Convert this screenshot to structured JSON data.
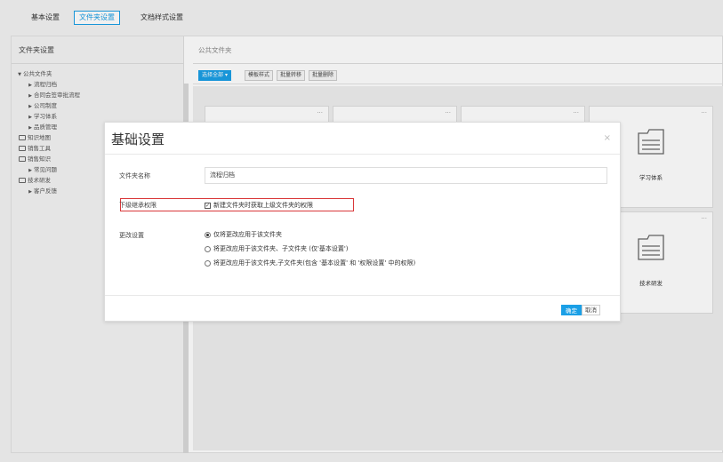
{
  "topbar": {
    "tabs": [
      {
        "label": "基本设置",
        "active": false
      },
      {
        "label": "文件夹设置",
        "active": true
      },
      {
        "label": "文档样式设置",
        "active": false
      }
    ]
  },
  "sidebar": {
    "title": "文件夹设置",
    "tree": [
      {
        "label": "公共文件夹",
        "kind": "expanded"
      },
      {
        "label": "流程归档",
        "kind": "child"
      },
      {
        "label": "合同会签审批流程",
        "kind": "child"
      },
      {
        "label": "公司制度",
        "kind": "child"
      },
      {
        "label": "学习体系",
        "kind": "child"
      },
      {
        "label": "品质管理",
        "kind": "child"
      },
      {
        "label": "知识地图",
        "kind": "folder"
      },
      {
        "label": "销售工具",
        "kind": "folder"
      },
      {
        "label": "销售知识",
        "kind": "folder"
      },
      {
        "label": "常见问题",
        "kind": "child"
      },
      {
        "label": "技术研发",
        "kind": "folder"
      },
      {
        "label": "客户反馈",
        "kind": "child"
      }
    ]
  },
  "content": {
    "breadcrumb": "公共文件夹",
    "toolbar": {
      "select_all": "选择全部",
      "template_style": "模板样式",
      "batch_transfer": "批量转移",
      "batch_delete": "批量删除"
    },
    "cards": [
      {
        "name": "学习体系"
      },
      {
        "name": "技术研发"
      }
    ],
    "more_glyph": "···"
  },
  "modal": {
    "title": "基础设置",
    "close_glyph": "×",
    "folder_name_label": "文件夹名称",
    "folder_name_value": "流程归档",
    "inherit_label": "下级继承权限",
    "inherit_option": "新建文件夹时获取上级文件夹的权限",
    "inherit_checked": true,
    "change_label": "更改设置",
    "options": [
      {
        "label": "仅将更改应用于该文件夹",
        "selected": true
      },
      {
        "label": "将更改应用于该文件夹、子文件夹 (仅'基本设置')",
        "selected": false
      },
      {
        "label": "将更改应用于该文件夹,子文件夹(包含 '基本设置' 和 '权限设置' 中的权限)",
        "selected": false
      }
    ],
    "ok_label": "确定",
    "cancel_label": "取消"
  },
  "colors": {
    "accent": "#1a9fe6",
    "highlight_border": "#d9383a"
  }
}
